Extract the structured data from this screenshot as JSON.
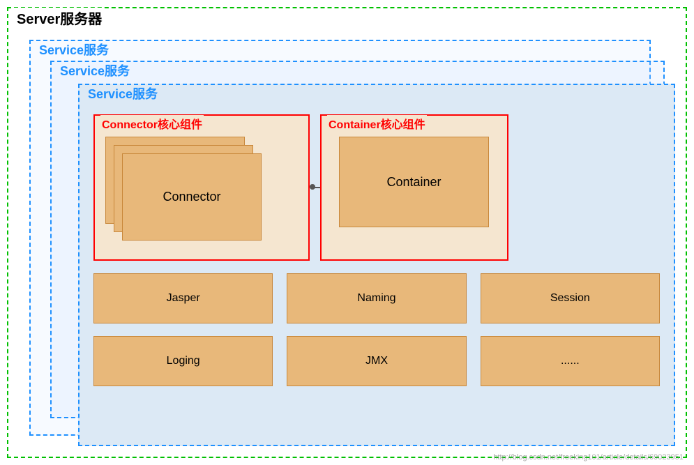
{
  "server": {
    "label": "Server服务器"
  },
  "services": [
    {
      "label": "Service服务"
    },
    {
      "label": "Service服务"
    },
    {
      "label": "Service服务"
    }
  ],
  "connector_core": {
    "label": "Connector核心组件",
    "connector_label": "Connector"
  },
  "container_core": {
    "label": "Container核心组件",
    "container_label": "Container"
  },
  "utility_row1": [
    {
      "label": "Jasper"
    },
    {
      "label": "Naming"
    },
    {
      "label": "Session"
    }
  ],
  "utility_row2": [
    {
      "label": "Loging"
    },
    {
      "label": "JMX"
    },
    {
      "label": "......"
    }
  ],
  "watermark": "http://blog.csdn.net/freeking101/article/details/69023951"
}
